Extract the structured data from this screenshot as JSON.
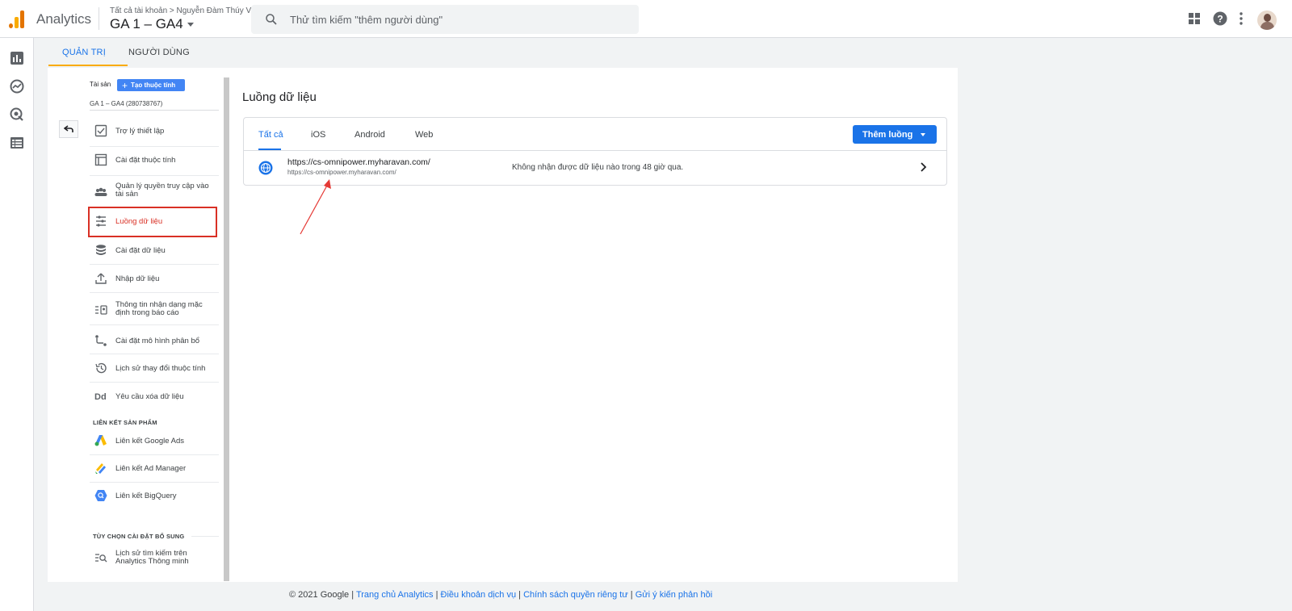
{
  "app": {
    "name": "Analytics"
  },
  "header": {
    "breadcrumb": "Tất cả tài khoản > Nguyễn Đàm Thúy Vy",
    "property": "GA 1 – GA4",
    "search_placeholder": "Thử tìm kiếm \"thêm người dùng\""
  },
  "tabs": {
    "admin": "QUẢN TRỊ",
    "users": "NGƯỜI DÙNG"
  },
  "nav": {
    "property_label": "Tài sản",
    "create_property": "Tạo thuộc tính",
    "property_id": "GA 1 – GA4 (280738767)",
    "items": [
      {
        "label": "Trợ lý thiết lập",
        "icon": "checkbox-icon"
      },
      {
        "label": "Cài đặt thuộc tính",
        "icon": "property-settings-icon"
      },
      {
        "label": "Quản lý quyền truy cập vào tài sản",
        "icon": "people-icon"
      },
      {
        "label": "Luồng dữ liệu",
        "icon": "data-streams-icon",
        "selected": true
      },
      {
        "label": "Cài đặt dữ liệu",
        "icon": "database-icon"
      },
      {
        "label": "Nhập dữ liệu",
        "icon": "upload-icon"
      },
      {
        "label": "Thông tin nhận dạng mặc định trong báo cáo",
        "icon": "reporting-identity-icon"
      },
      {
        "label": "Cài đặt mô hình phân bổ",
        "icon": "attribution-icon"
      },
      {
        "label": "Lịch sử thay đổi thuộc tính",
        "icon": "history-icon"
      },
      {
        "label": "Yêu cầu xóa dữ liệu",
        "icon": "data-deletion-icon"
      }
    ],
    "product_links_heading": "LIÊN KẾT SẢN PHẨM",
    "product_links": [
      {
        "label": "Liên kết Google Ads",
        "icon": "google-ads-icon"
      },
      {
        "label": "Liên kết Ad Manager",
        "icon": "ad-manager-icon"
      },
      {
        "label": "Liên kết BigQuery",
        "icon": "bigquery-icon"
      }
    ],
    "additional_heading": "TÙY CHỌN CÀI ĐẶT BỔ SUNG",
    "additional": [
      {
        "label": "Lịch sử tìm kiếm trên Analytics Thông minh",
        "icon": "search-history-icon"
      }
    ]
  },
  "content": {
    "title": "Luồng dữ liệu",
    "stream_tabs": [
      "Tất cả",
      "iOS",
      "Android",
      "Web"
    ],
    "add_stream": "Thêm luồng",
    "streams": [
      {
        "name": "https://cs-omnipower.myharavan.com/",
        "url": "https://cs-omnipower.myharavan.com/",
        "status": "Không nhận được dữ liệu nào trong 48 giờ qua."
      }
    ]
  },
  "footer": {
    "copyright": "© 2021 Google |",
    "links": [
      "Trang chủ Analytics",
      "Điều khoản dịch vụ",
      "Chính sách quyền riêng tư",
      "Gửi ý kiến phản hồi"
    ],
    "separator": "|"
  },
  "colors": {
    "accent": "#1a73e8",
    "highlight": "#d93025",
    "tab_underline": "#f9ab00"
  }
}
